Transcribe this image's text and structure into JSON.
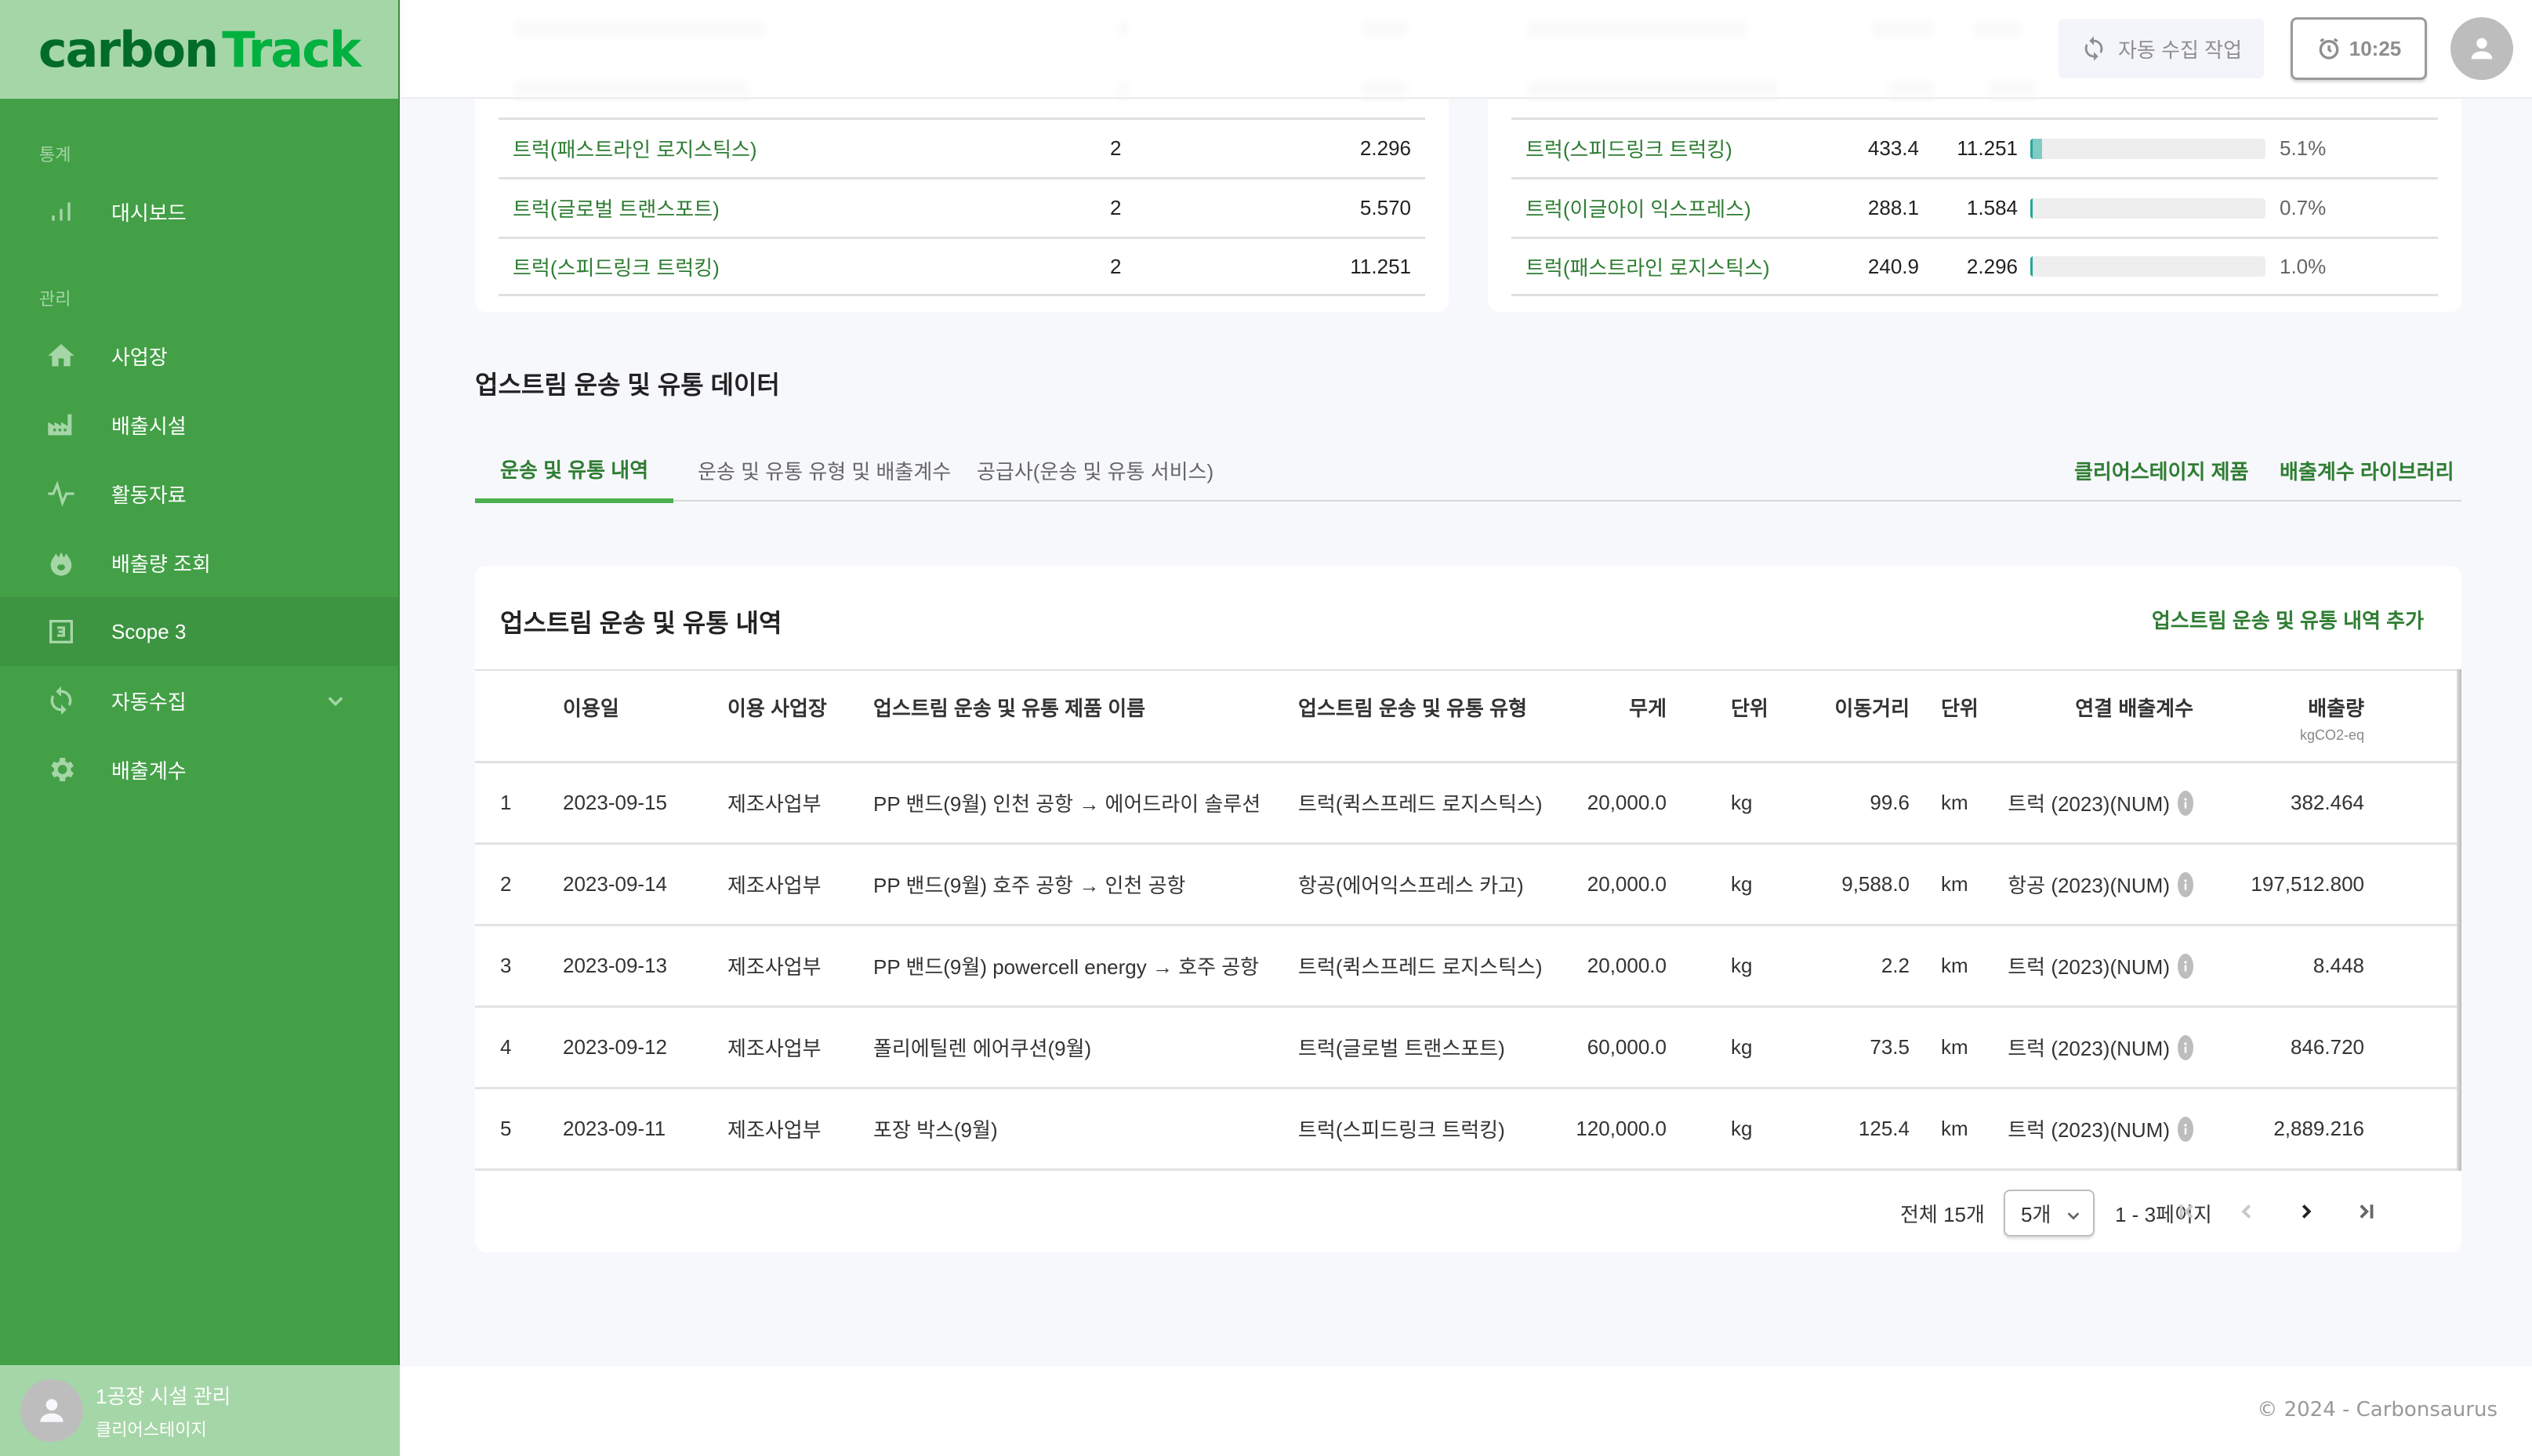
{
  "app": {
    "logo_part1": "carbon",
    "logo_part2": "Track",
    "brand_color": "#43a047",
    "accent_color": "#2e7d32"
  },
  "sidebar": {
    "sections": [
      {
        "label": "통계"
      },
      {
        "label": "관리"
      }
    ],
    "items": [
      {
        "label": "대시보드",
        "icon": "bar-chart-icon"
      },
      {
        "label": "사업장",
        "icon": "home-icon"
      },
      {
        "label": "배출시설",
        "icon": "factory-icon"
      },
      {
        "label": "활동자료",
        "icon": "activity-icon"
      },
      {
        "label": "배출량 조회",
        "icon": "fire-icon"
      },
      {
        "label": "Scope 3",
        "icon": "scope3-icon",
        "active": true
      },
      {
        "label": "자동수집",
        "icon": "sync-icon",
        "expandable": true
      },
      {
        "label": "배출계수",
        "icon": "gear-icon"
      }
    ],
    "user": {
      "name": "1공장 시설 관리",
      "org": "클리어스테이지"
    }
  },
  "header": {
    "auto_collect_label": "자동 수집 작업",
    "time_label": "10:25"
  },
  "summary_left": {
    "rows": [
      {
        "name": "트럭(패스트라인 로지스틱스)",
        "count": "2",
        "value": "2.296"
      },
      {
        "name": "트럭(글로벌 트랜스포트)",
        "count": "2",
        "value": "5.570"
      },
      {
        "name": "트럭(스피드링크 트럭킹)",
        "count": "2",
        "value": "11.251"
      }
    ]
  },
  "summary_right": {
    "rows": [
      {
        "name": "트럭(스피드링크 트럭킹)",
        "distance": "433.4",
        "value": "11.251",
        "percent": 5.1,
        "percent_label": "5.1%"
      },
      {
        "name": "트럭(이글아이 익스프레스)",
        "distance": "288.1",
        "value": "1.584",
        "percent": 0.7,
        "percent_label": "0.7%"
      },
      {
        "name": "트럭(패스트라인 로지스틱스)",
        "distance": "240.9",
        "value": "2.296",
        "percent": 1.0,
        "percent_label": "1.0%"
      }
    ]
  },
  "section": {
    "title": "업스트림 운송 및 유통 데이터",
    "tabs": [
      {
        "label": "운송 및 유통 내역",
        "active": true
      },
      {
        "label": "운송 및 유통 유형 및 배출계수"
      },
      {
        "label": "공급사(운송 및 유통 서비스)"
      }
    ],
    "links": [
      {
        "label": "클리어스테이지 제품"
      },
      {
        "label": "배출계수 라이브러리"
      }
    ]
  },
  "table": {
    "title": "업스트림 운송 및 유통 내역",
    "add_label": "업스트림 운송 및 유통 내역 추가",
    "columns": {
      "date": "이용일",
      "site": "이용 사업장",
      "product": "업스트림 운송 및 유통 제품 이름",
      "type": "업스트림 운송 및 유통 유형",
      "weight": "무게",
      "weight_unit": "단위",
      "distance": "이동거리",
      "distance_unit": "단위",
      "factor": "연결 배출계수",
      "emission": "배출량",
      "emission_unit": "kgCO2-eq"
    },
    "rows": [
      {
        "no": "1",
        "date": "2023-09-15",
        "site": "제조사업부",
        "product": "PP 밴드(9월) 인천 공항 → 에어드라이 솔루션",
        "type": "트럭(퀵스프레드 로지스틱스)",
        "weight": "20,000.0",
        "weight_unit": "kg",
        "distance": "99.6",
        "distance_unit": "km",
        "factor": "트럭 (2023)(NUM)",
        "emission": "382.464"
      },
      {
        "no": "2",
        "date": "2023-09-14",
        "site": "제조사업부",
        "product": "PP 밴드(9월) 호주 공항 → 인천 공항",
        "type": "항공(에어익스프레스 카고)",
        "weight": "20,000.0",
        "weight_unit": "kg",
        "distance": "9,588.0",
        "distance_unit": "km",
        "factor": "항공 (2023)(NUM)",
        "emission": "197,512.800"
      },
      {
        "no": "3",
        "date": "2023-09-13",
        "site": "제조사업부",
        "product": "PP 밴드(9월) powercell energy → 호주 공항",
        "type": "트럭(퀵스프레드 로지스틱스)",
        "weight": "20,000.0",
        "weight_unit": "kg",
        "distance": "2.2",
        "distance_unit": "km",
        "factor": "트럭 (2023)(NUM)",
        "emission": "8.448"
      },
      {
        "no": "4",
        "date": "2023-09-12",
        "site": "제조사업부",
        "product": "폴리에틸렌 에어쿠션(9월)",
        "type": "트럭(글로벌 트랜스포트)",
        "weight": "60,000.0",
        "weight_unit": "kg",
        "distance": "73.5",
        "distance_unit": "km",
        "factor": "트럭 (2023)(NUM)",
        "emission": "846.720"
      },
      {
        "no": "5",
        "date": "2023-09-11",
        "site": "제조사업부",
        "product": "포장 박스(9월)",
        "type": "트럭(스피드링크 트럭킹)",
        "weight": "120,000.0",
        "weight_unit": "kg",
        "distance": "125.4",
        "distance_unit": "km",
        "factor": "트럭 (2023)(NUM)",
        "emission": "2,889.216"
      }
    ],
    "pagination": {
      "total_label": "전체 15개",
      "page_size_label": "5개",
      "range_label": "1 - 3페이지"
    }
  },
  "footer": {
    "copyright": "© 2024 - Carbonsaurus"
  }
}
